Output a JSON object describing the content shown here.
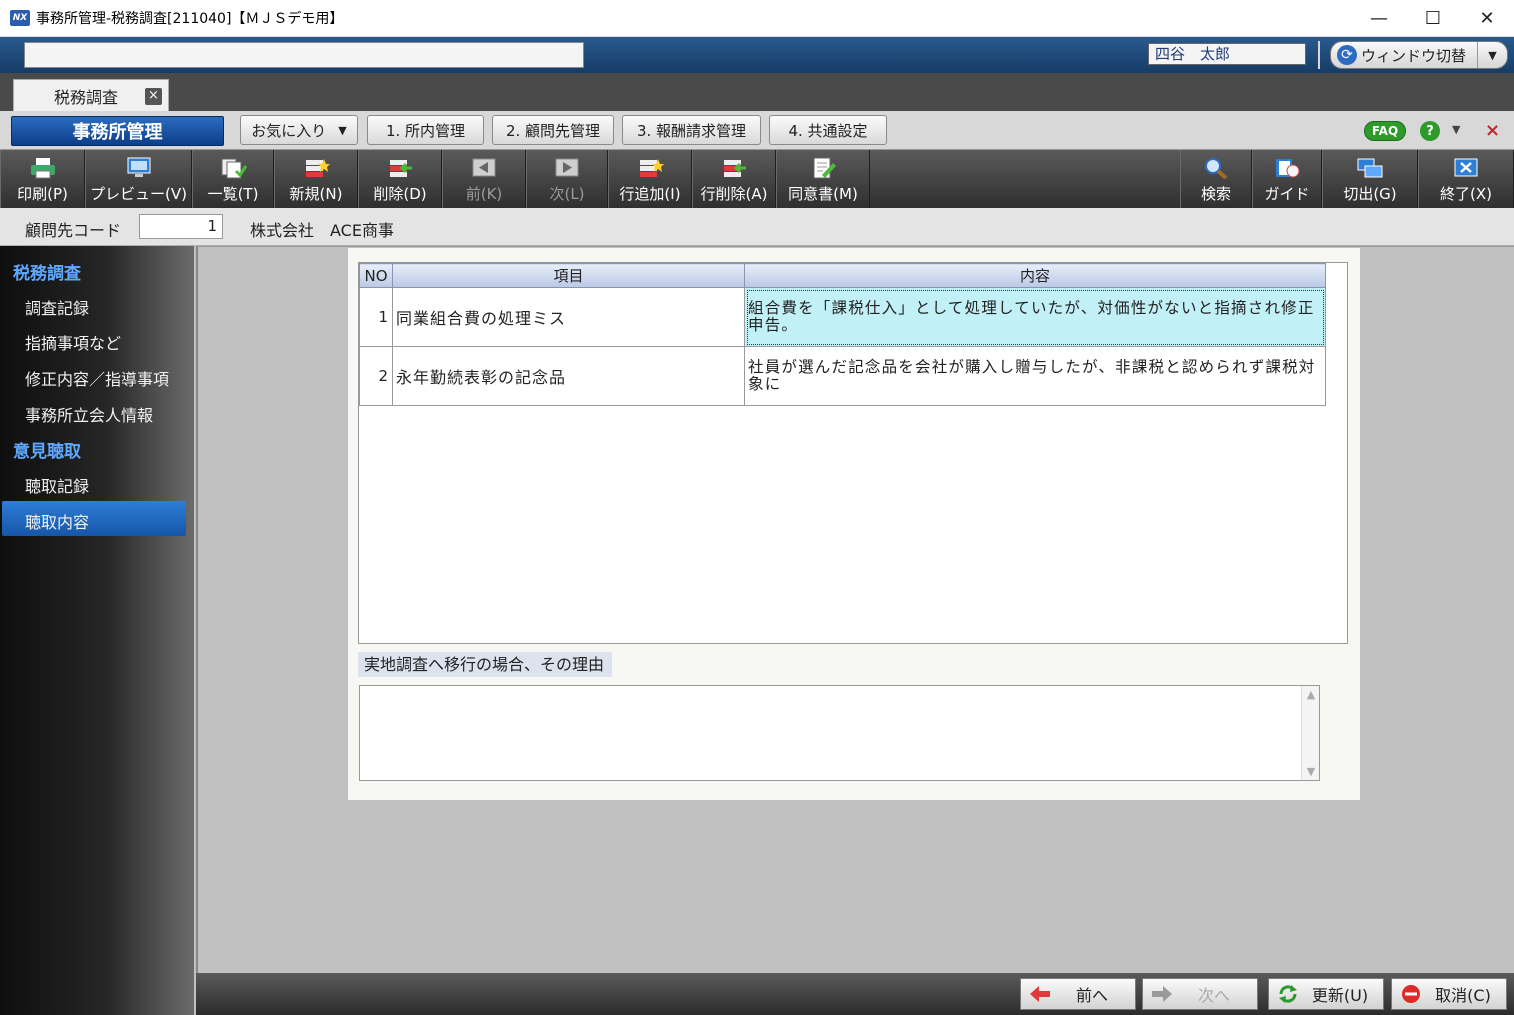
{
  "window": {
    "title": "事務所管理-税務調査[211040]【ＭＪＳデモ用】",
    "app_icon": "NX",
    "minimize": "—",
    "maximize": "☐",
    "close": "✕"
  },
  "header": {
    "user_name": "四谷　太郎",
    "window_switch_label": "ウィンドウ切替"
  },
  "tabs": [
    {
      "label": "税務調査",
      "close": "×"
    }
  ],
  "menu": {
    "system_label": "事務所管理",
    "favorites_label": "お気に入り",
    "items": [
      "1. 所内管理",
      "2. 顧問先管理",
      "3. 報酬請求管理",
      "4. 共通設定"
    ],
    "faq_label": "FAQ",
    "help_label": "?"
  },
  "toolbar": {
    "print": "印刷(P)",
    "preview": "プレビュー(V)",
    "list": "一覧(T)",
    "new": "新規(N)",
    "delete": "削除(D)",
    "prev": "前(K)",
    "next": "次(L)",
    "add_row": "行追加(I)",
    "delete_row": "行削除(A)",
    "consent": "同意書(M)",
    "search": "検索",
    "guide": "ガイド",
    "switch": "切出(G)",
    "exit": "終了(X)"
  },
  "client": {
    "code_label": "顧問先コード",
    "code_value": "1",
    "name": "株式会社　ACE商事"
  },
  "sidebar": {
    "sections": [
      {
        "title": "税務調査",
        "items": [
          "調査記録",
          "指摘事項など",
          "修正内容／指導事項",
          "事務所立会人情報"
        ]
      },
      {
        "title": "意見聴取",
        "items": [
          "聴取記録",
          "聴取内容"
        ]
      }
    ],
    "selected": "聴取内容"
  },
  "grid": {
    "columns": [
      "NO",
      "項目",
      "内容"
    ],
    "rows": [
      {
        "no": "1",
        "item": "同業組合費の処理ミス",
        "content": "組合費を「課税仕入」として処理していたが、対価性がないと指摘され修正申告。"
      },
      {
        "no": "2",
        "item": "永年勤続表彰の記念品",
        "content": "社員が選んだ記念品を会社が購入し贈与したが、非課税と認められず課税対象に"
      }
    ]
  },
  "reason": {
    "label": "実地調査へ移行の場合、その理由",
    "value": ""
  },
  "footer": {
    "prev": "前へ",
    "next": "次へ",
    "update": "更新(U)",
    "cancel": "取消(C)"
  }
}
